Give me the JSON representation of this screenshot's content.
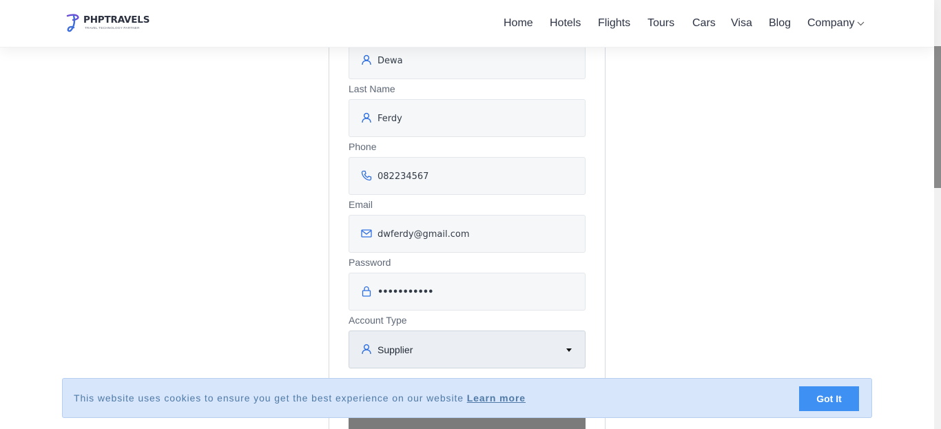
{
  "brand": {
    "name": "PHPTRAVELS",
    "tagline": "TRAVEL TECHNOLOGY PARTNER",
    "accent": "#3e6fd8"
  },
  "nav": {
    "items": [
      "Home",
      "Hotels",
      "Flights",
      "Tours",
      "Cars",
      "Visa",
      "Blog",
      "Company"
    ],
    "dropdown_icon": "chevron-down-icon"
  },
  "form": {
    "first_name": {
      "value": "Dewa",
      "icon": "user-icon"
    },
    "last_name": {
      "label": "Last Name",
      "value": "Ferdy",
      "icon": "user-icon"
    },
    "phone": {
      "label": "Phone",
      "value": "082234567",
      "icon": "phone-icon"
    },
    "email": {
      "label": "Email",
      "value": "dwferdy@gmail.com",
      "icon": "mail-icon"
    },
    "password": {
      "label": "Password",
      "value": "•••••••••••",
      "icon": "lock-icon"
    },
    "account_type": {
      "label": "Account Type",
      "selected": "Supplier",
      "icon": "user-icon"
    }
  },
  "cookie": {
    "message": "This website uses cookies to ensure you get the best experience on our website",
    "link": "Learn more",
    "button": "Got It",
    "button_color": "#3e90f3"
  },
  "colors": {
    "icon_blue": "#2e6fe0",
    "field_bg": "#f5f7f9",
    "banner_bg": "#d7e6fb"
  }
}
